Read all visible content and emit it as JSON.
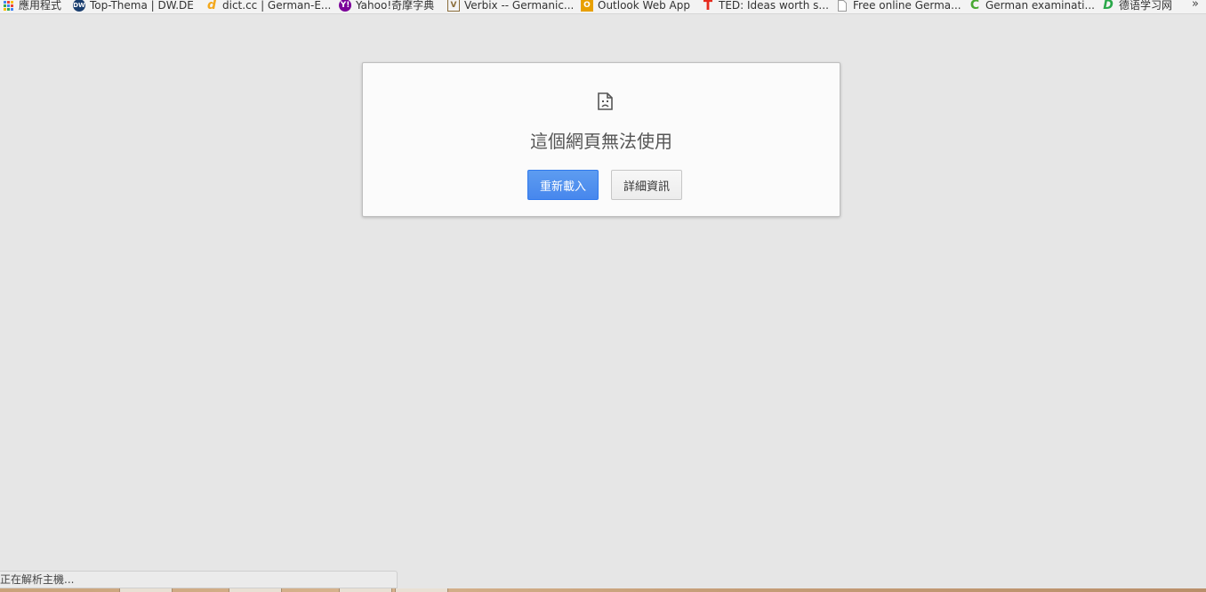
{
  "bookmarks": [
    {
      "label": "應用程式",
      "icon": "apps-grid-icon",
      "color": "#4285f4"
    },
    {
      "label": "Top-Thema | DW.DE",
      "icon": "dw-logo-icon",
      "color": "#1a3e6f"
    },
    {
      "label": "dict.cc | German-E...",
      "icon": "dict-cc-icon",
      "color": "#f3a81c"
    },
    {
      "label": "Yahoo!奇摩字典",
      "icon": "yahoo-icon",
      "color": "#7b0099"
    },
    {
      "label": "Verbix -- Germanic...",
      "icon": "verbix-icon",
      "color": "#8a6d3b"
    },
    {
      "label": "Outlook Web App",
      "icon": "outlook-icon",
      "color": "#e8a000"
    },
    {
      "label": "TED: Ideas worth s...",
      "icon": "ted-icon",
      "color": "#e62b1e"
    },
    {
      "label": "Free online Germa...",
      "icon": "page-icon",
      "color": "#9a9a9a"
    },
    {
      "label": "German examinati...",
      "icon": "german-exam-icon",
      "color": "#48a832"
    },
    {
      "label": "德语学习网",
      "icon": "deyu-icon",
      "color": "#2aa84a"
    }
  ],
  "bookmarks_overflow": "»",
  "error": {
    "title": "這個網頁無法使用",
    "reload_label": "重新載入",
    "details_label": "詳細資訊"
  },
  "status": {
    "text": "正在解析主機..."
  },
  "colors": {
    "background": "#e6e6e6",
    "primary_button": "#4787ed",
    "card": "#fbfbfb"
  }
}
